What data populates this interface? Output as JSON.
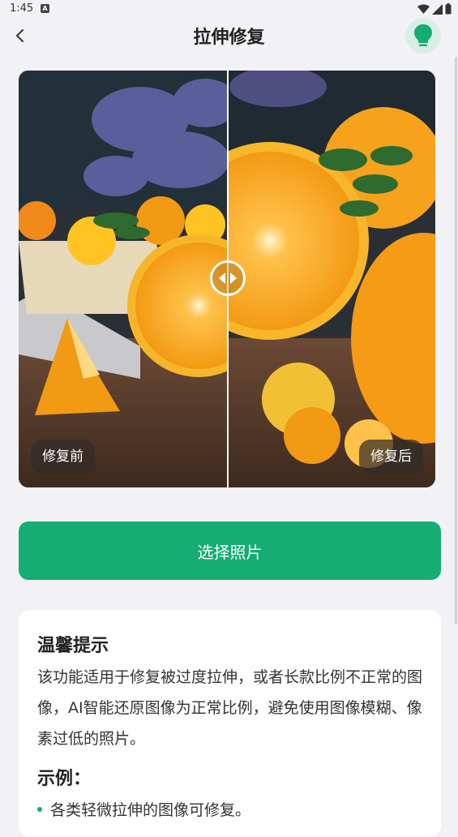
{
  "status_bar": {
    "time": "1:45",
    "notification_glyph": "A"
  },
  "header": {
    "title": "拉伸修复",
    "back_icon": "chevron-left-icon",
    "help_icon": "lightbulb-icon"
  },
  "compare": {
    "before_label": "修复前",
    "after_label": "修复后",
    "handle_icon": "left-right-arrows-icon"
  },
  "actions": {
    "choose_photo": "选择照片"
  },
  "tips": {
    "title": "温馨提示",
    "body": "该功能适用于修复被过度拉伸，或者长款比例不正常的图像，AI智能还原图像为正常比例，避免使用图像模糊、像素过低的照片。",
    "example_title": "示例：",
    "examples": [
      "各类轻微拉伸的图像可修复。"
    ]
  },
  "colors": {
    "accent": "#15ad72",
    "background": "#f2f2f6"
  }
}
